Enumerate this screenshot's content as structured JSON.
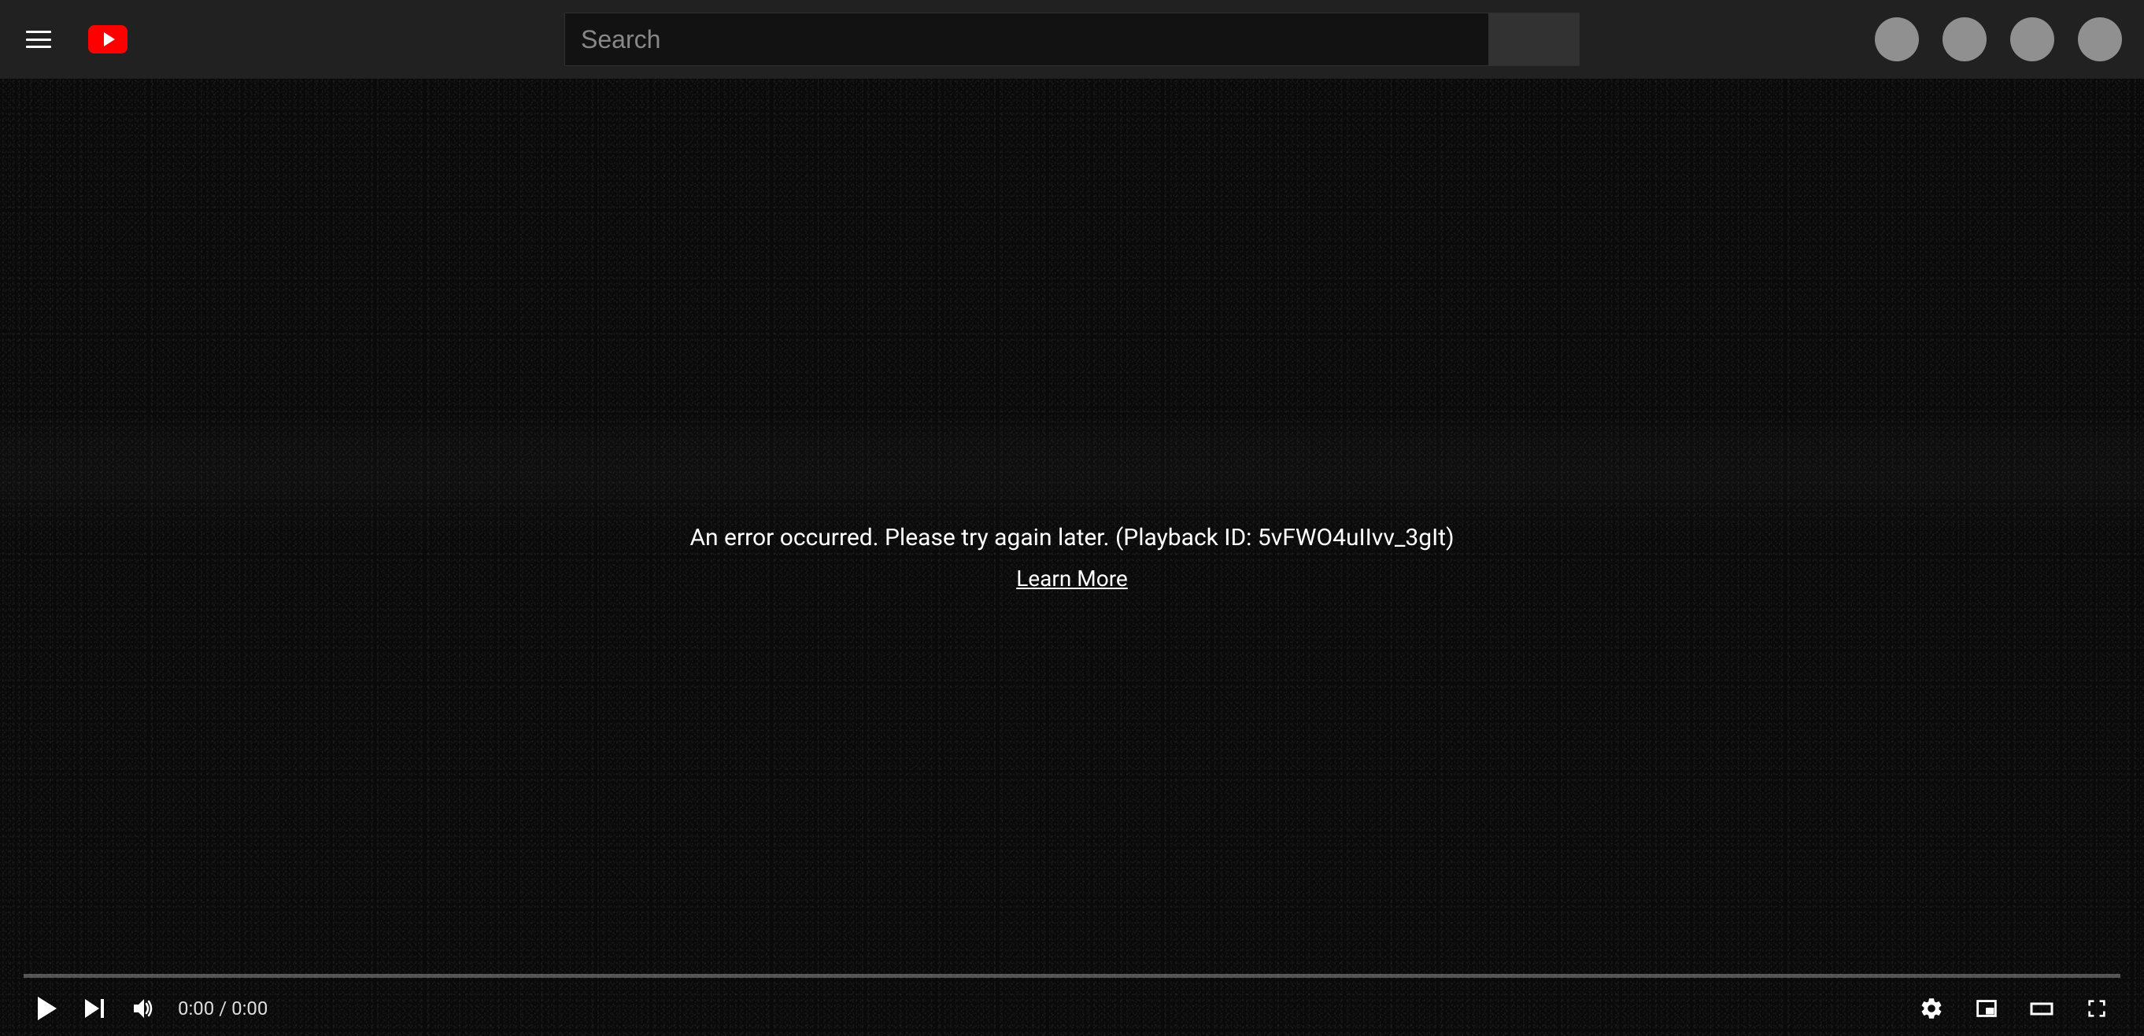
{
  "header": {
    "search_placeholder": "Search"
  },
  "player": {
    "error_message": "An error occurred. Please try again later. (Playback ID: 5vFWO4uIIvv_3gIt)",
    "learn_more_label": "Learn More",
    "time_display": "0:00 / 0:00"
  }
}
